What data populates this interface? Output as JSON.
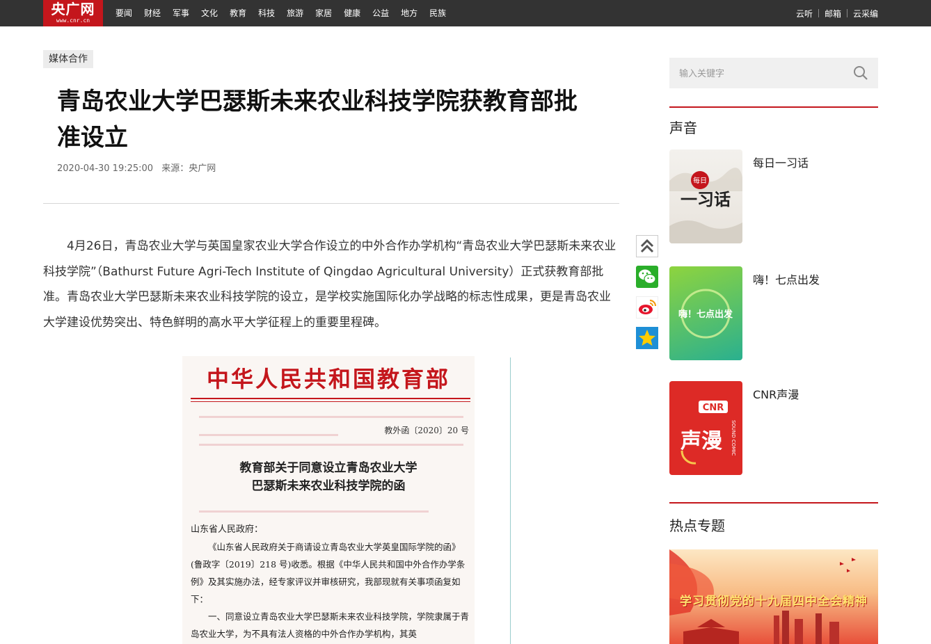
{
  "header": {
    "logo_text": "央广网",
    "logo_url": "www.cnr.cn",
    "nav": [
      "要闻",
      "财经",
      "军事",
      "文化",
      "教育",
      "科技",
      "旅游",
      "家居",
      "健康",
      "公益",
      "地方",
      "民族"
    ],
    "right_links": [
      "云听",
      "邮箱",
      "云采编"
    ]
  },
  "article": {
    "tag": "媒体合作",
    "title": "青岛农业大学巴瑟斯未来农业科技学院获教育部批准设立",
    "date": "2020-04-30 19:25:00",
    "source": "来源：央广网",
    "paragraph": "4月26日，青岛农业大学与英国皇家农业大学合作设立的中外合作办学机构“青岛农业大学巴瑟斯未来农业科技学院”（Bathurst Future Agri-Tech Institute of Qingdao Agricultural University）正式获教育部批准。青岛农业大学巴瑟斯未来农业科技学院的设立，是学校实施国际化办学战略的标志性成果，更是青岛农业大学建设优势突出、特色鲜明的高水平大学征程上的重要里程碑。",
    "document": {
      "ministry": "中华人民共和国教育部",
      "doc_no": "教外函〔2020〕20 号",
      "title_line1": "教育部关于同意设立青岛农业大学",
      "title_line2": "巴瑟斯未来农业科技学院的函",
      "addressee": "山东省人民政府：",
      "body1": "《山东省人民政府关于商请设立青岛农业大学英皇国际学院的函》(鲁政字〔2019〕218 号)收悉。根据《中华人民共和国中外合作办学条例》及其实施办法，经专家评议并审核研究，我部现就有关事项函复如下：",
      "body2": "一、同意设立青岛农业大学巴瑟斯未来农业科技学院，学院隶属于青岛农业大学，为不具有法人资格的中外合作办学机构，其英"
    }
  },
  "share": [
    "back-to-top",
    "wechat",
    "weibo",
    "qzone"
  ],
  "sidebar": {
    "search_placeholder": "输入关键字",
    "voice_title": "声音",
    "voice_items": [
      {
        "label": "每日一习话",
        "thumb_text": "一习话",
        "thumb_top": "每日"
      },
      {
        "label": "嗨！七点出发",
        "thumb_text": "嗨！七点出发"
      },
      {
        "label": "CNR声漫",
        "thumb_text": "声漫",
        "thumb_top": "CNR",
        "thumb_side": "SOUND COMIC"
      }
    ],
    "hot_title": "热点专题",
    "banner_text": "学习贯彻党的十九届四中全会精神"
  },
  "colors": {
    "brand_red": "#c4161c",
    "topbar": "#333333"
  }
}
